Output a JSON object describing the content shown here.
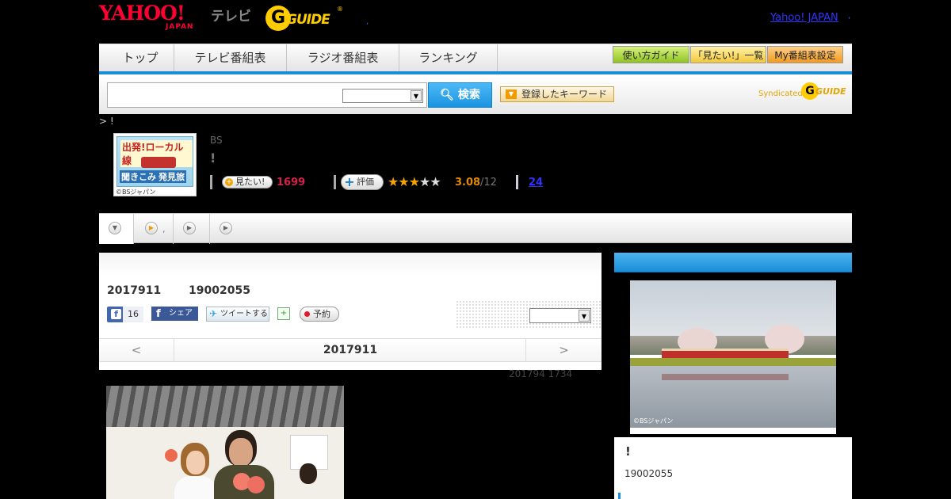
{
  "header": {
    "yahoo_logo": "YAHOO!",
    "yahoo_sub": "JAPAN",
    "tv_label": "テレビ",
    "guide_logo": "GUIDE",
    "guide_mark": "®",
    "hdr_dot": ",",
    "yahoo_japan_link": "Yahoo! JAPAN",
    "link_dot": ","
  },
  "nav": {
    "tabs": [
      "トップ",
      "テレビ番組表",
      "ラジオ番組表",
      "ランキング"
    ],
    "buttons": [
      "使い方ガイド",
      "「見たい!」一覧",
      "My番組表設定"
    ]
  },
  "search": {
    "input_value": "",
    "select_value": "",
    "button_label": "検索",
    "keyword_button": "登録したキーワード",
    "syndicated": "Syndicated",
    "syndicated_logo": "GUIDE"
  },
  "breadcrumb": "> !",
  "program": {
    "thumb_title": "出発!ローカル線",
    "thumb_sub1": "聞きこみ",
    "thumb_sub2": "発見旅",
    "thumb_credit": "©BSジャパン",
    "channel": "BS",
    "title": "!",
    "mitai_label": "見たい!",
    "mitai_count": "1699",
    "hyoka_label": "評価",
    "rating": "3.08",
    "rating_max": "/12",
    "rating_stars": 3.08,
    "review_count": "24"
  },
  "subtabs": {
    "tab2_text": ","
  },
  "episode": {
    "date": "2017911",
    "id": "19002055",
    "fb_like_count": "16",
    "fb_share": "シェア",
    "tweet": "ツイートする",
    "reserve": "予約",
    "select_value": "",
    "pager_prev": "<",
    "pager_current": "2017911",
    "pager_next": ">",
    "updated": "201794  1734"
  },
  "side": {
    "image_credit": "©BSジャパン",
    "title": "!",
    "id": "19002055"
  },
  "icons": {
    "search": "search-icon",
    "plus": "plus-icon",
    "star": "star-icon",
    "facebook": "facebook-icon",
    "twitter": "twitter-icon",
    "calendar": "calendar-icon",
    "record": "record-dot-icon",
    "dropdown": "chevron-down-icon",
    "play": "play-icon"
  },
  "colors": {
    "accent_blue": "#1a8ed8",
    "yahoo_red": "#ff0033",
    "guide_yellow": "#ffcc00",
    "mitai_pink": "#d8204f",
    "rating_orange": "#e38a00"
  }
}
